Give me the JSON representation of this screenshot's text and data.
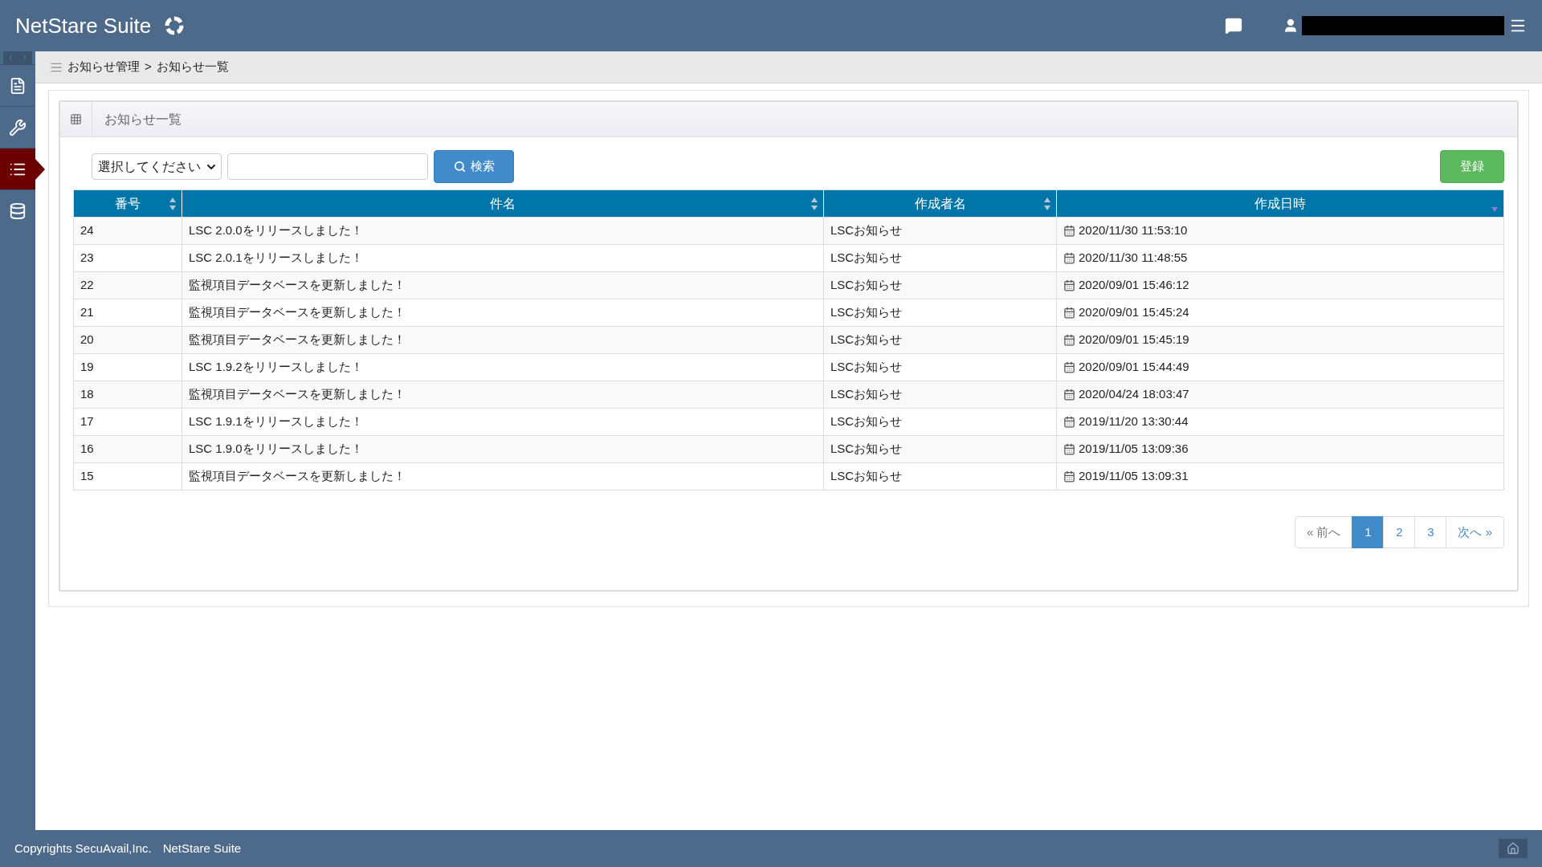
{
  "header": {
    "title": "NetStare Suite"
  },
  "sidebar": {
    "collapsed": false,
    "items": [
      {
        "selected": false
      },
      {
        "selected": false
      },
      {
        "selected": true
      },
      {
        "selected": false
      }
    ]
  },
  "breadcrumb": [
    "お知らせ管理",
    "お知らせ一覧"
  ],
  "breadcrumb_separator": ">",
  "panel": {
    "title": "お知らせ一覧"
  },
  "search": {
    "select_value": "選択してください",
    "button": "検索"
  },
  "register_button": "登録",
  "table": {
    "columns": [
      {
        "label": "番号",
        "sorted": false
      },
      {
        "label": "件名",
        "sorted": false
      },
      {
        "label": "作成者名",
        "sorted": false
      },
      {
        "label": "作成日時",
        "sorted": true
      }
    ],
    "rows": [
      [
        "24",
        "LSC 2.0.0をリリースしました！",
        "LSCお知らせ",
        "2020/11/30 11:53:10"
      ],
      [
        "23",
        "LSC 2.0.1をリリースしました！",
        "LSCお知らせ",
        "2020/11/30 11:48:55"
      ],
      [
        "22",
        "監視項目データベースを更新しました！",
        "LSCお知らせ",
        "2020/09/01 15:46:12"
      ],
      [
        "21",
        "監視項目データベースを更新しました！",
        "LSCお知らせ",
        "2020/09/01 15:45:24"
      ],
      [
        "20",
        "監視項目データベースを更新しました！",
        "LSCお知らせ",
        "2020/09/01 15:45:19"
      ],
      [
        "19",
        "LSC 1.9.2をリリースしました！",
        "LSCお知らせ",
        "2020/09/01 15:44:49"
      ],
      [
        "18",
        "監視項目データベースを更新しました！",
        "LSCお知らせ",
        "2020/04/24 18:03:47"
      ],
      [
        "17",
        "LSC 1.9.1をリリースしました！",
        "LSCお知らせ",
        "2019/11/20 13:30:44"
      ],
      [
        "16",
        "LSC 1.9.0をリリースしました！",
        "LSCお知らせ",
        "2019/11/05 13:09:36"
      ],
      [
        "15",
        "監視項目データベースを更新しました！",
        "LSCお知らせ",
        "2019/11/05 13:09:31"
      ]
    ]
  },
  "pagination": {
    "prev": "« 前へ",
    "pages": [
      {
        "label": "1",
        "selected": true
      },
      {
        "label": "2",
        "selected": false
      },
      {
        "label": "3",
        "selected": false
      }
    ],
    "next": "次へ »"
  },
  "footer": {
    "copyright": "Copyrights SecuAvail,Inc.",
    "product": "NetStare Suite"
  }
}
